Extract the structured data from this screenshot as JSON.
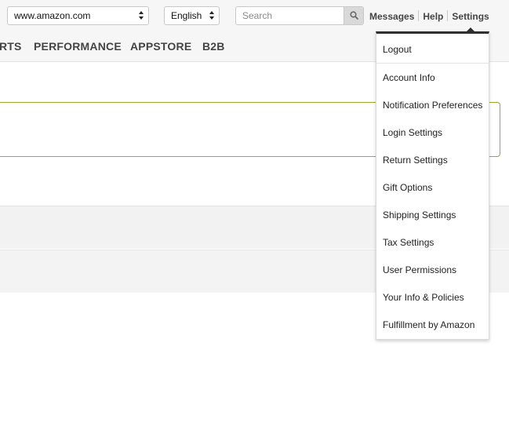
{
  "header": {
    "marketplace_select": "www.amazon.com",
    "language_select": "English",
    "search_placeholder": "Search",
    "links": {
      "messages": "Messages",
      "help": "Help",
      "settings": "Settings"
    }
  },
  "nav": {
    "tabs": [
      "RTS",
      "PERFORMANCE",
      "APPSTORE",
      "B2B"
    ]
  },
  "settings_menu": {
    "items": [
      "Logout",
      "Account Info",
      "Notification Preferences",
      "Login Settings",
      "Return Settings",
      "Gift Options",
      "Shipping Settings",
      "Tax Settings",
      "User Permissions",
      "Your Info & Policies",
      "Fulfillment by Amazon"
    ]
  },
  "icons": {
    "search": "search-icon",
    "select_arrows": "updown-arrows-icon"
  },
  "colors": {
    "alert_border": "#9aaa2a",
    "menu_top_border": "#2f2f2f",
    "search_button": "#d9d9d9"
  }
}
